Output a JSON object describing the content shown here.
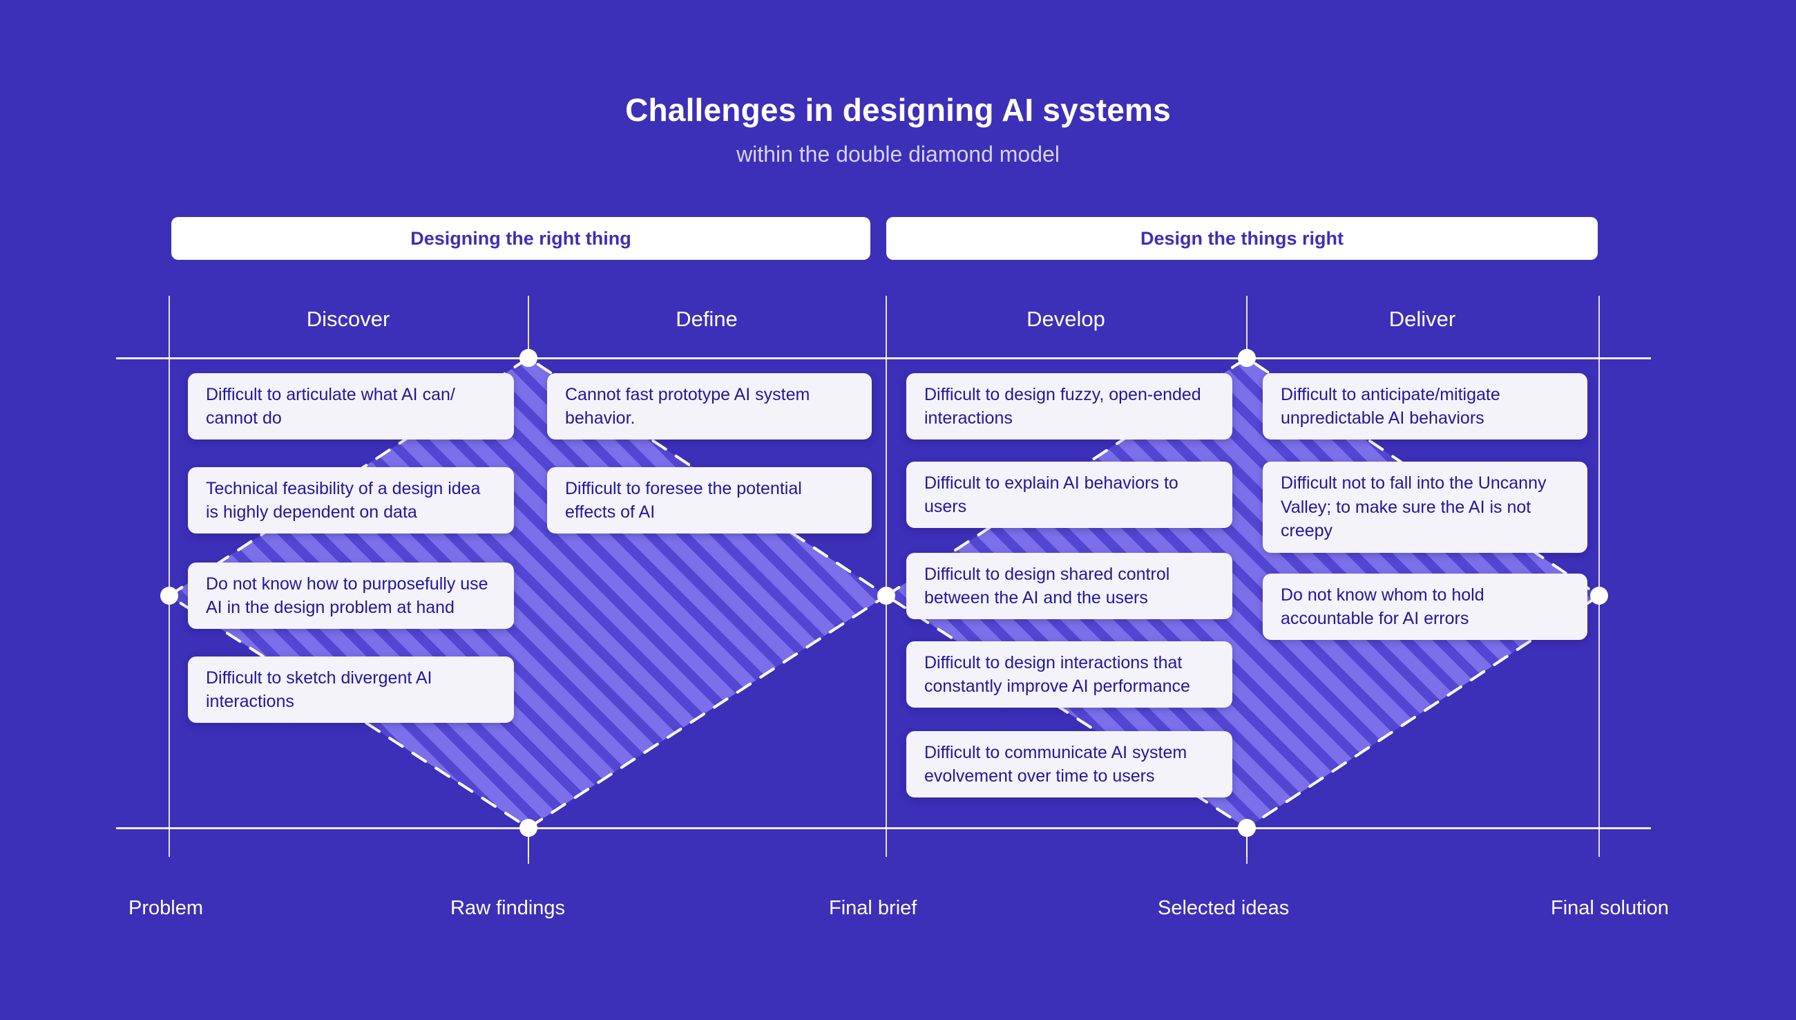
{
  "header": {
    "title": "Challenges in designing AI systems",
    "subtitle": "within the double diamond model"
  },
  "colors": {
    "background": "#3C2FB8",
    "diamond_fill": "#7B70EA",
    "diamond_stripe": "#4638C8",
    "card_bg": "#F4F3FA",
    "card_text": "#21179E",
    "pill_bg": "#FFFFFF",
    "pill_text": "#3C2FB8",
    "line": "#FFFFFF"
  },
  "pills": [
    {
      "label": "Designing the right thing"
    },
    {
      "label": "Design the things right"
    }
  ],
  "phases": [
    {
      "label": "Discover"
    },
    {
      "label": "Define"
    },
    {
      "label": "Develop"
    },
    {
      "label": "Deliver"
    }
  ],
  "axis_labels": [
    {
      "label": "Problem"
    },
    {
      "label": "Raw findings"
    },
    {
      "label": "Final brief"
    },
    {
      "label": "Selected ideas"
    },
    {
      "label": "Final solution"
    }
  ],
  "columns": {
    "discover": [
      {
        "text": "Difficult to articulate what AI can/ cannot do"
      },
      {
        "text": "Technical feasibility of a design idea is highly dependent on data"
      },
      {
        "text": "Do not know how to purposefully use AI in the design problem at hand"
      },
      {
        "text": "Difficult to sketch divergent AI interactions"
      }
    ],
    "define": [
      {
        "text": "Cannot fast prototype AI system behavior."
      },
      {
        "text": "Difficult to foresee the potential effects of AI"
      }
    ],
    "develop": [
      {
        "text": "Difficult to design fuzzy, open-ended interactions"
      },
      {
        "text": "Difficult to explain AI behaviors to users"
      },
      {
        "text": "Difficult to design shared control between the AI and the users"
      },
      {
        "text": "Difficult to design interactions that constantly improve AI performance"
      },
      {
        "text": "Difficult to communicate AI system evolvement over time to users"
      }
    ],
    "deliver": [
      {
        "text": "Difficult to anticipate/mitigate unpredictable AI behaviors"
      },
      {
        "text": "Difficult not to fall into the Uncanny Valley; to make sure the AI is not creepy"
      },
      {
        "text": "Do not know whom to hold accountable for AI errors"
      }
    ]
  }
}
